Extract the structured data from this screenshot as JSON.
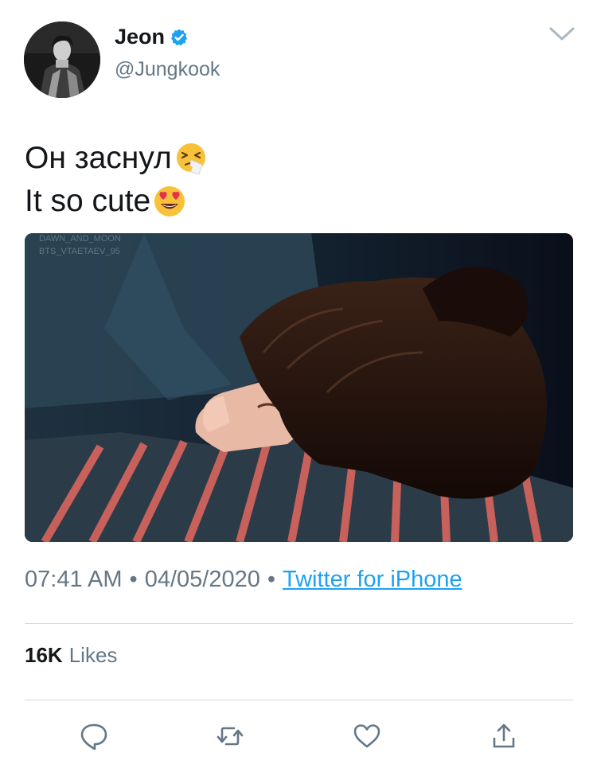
{
  "author": {
    "display_name": "Jeon",
    "handle": "@Jungkook",
    "verified": true,
    "avatar": "profile-photo"
  },
  "tweet": {
    "lines": [
      {
        "text": "Он заснул",
        "emoji": "sneezing-face"
      },
      {
        "text": "It so cute",
        "emoji": "heart-eyes-face"
      }
    ],
    "media": {
      "type": "photo",
      "watermark": [
        "DAWN_AND_MOON",
        "BTS_VTAETAEV_95"
      ]
    }
  },
  "meta": {
    "time": "07:41 AM",
    "separator": "•",
    "date": "04/05/2020",
    "source": "Twitter for iPhone"
  },
  "stats": {
    "likes_count": "16K",
    "likes_label": "Likes"
  },
  "actions": [
    {
      "name": "reply",
      "icon": "reply-icon"
    },
    {
      "name": "retweet",
      "icon": "retweet-icon"
    },
    {
      "name": "like",
      "icon": "heart-icon"
    },
    {
      "name": "share",
      "icon": "share-icon"
    }
  ],
  "colors": {
    "text": "#14171a",
    "secondary": "#657786",
    "link": "#1da1f2",
    "divider": "#d3d9de",
    "verified": "#1da1f2"
  }
}
